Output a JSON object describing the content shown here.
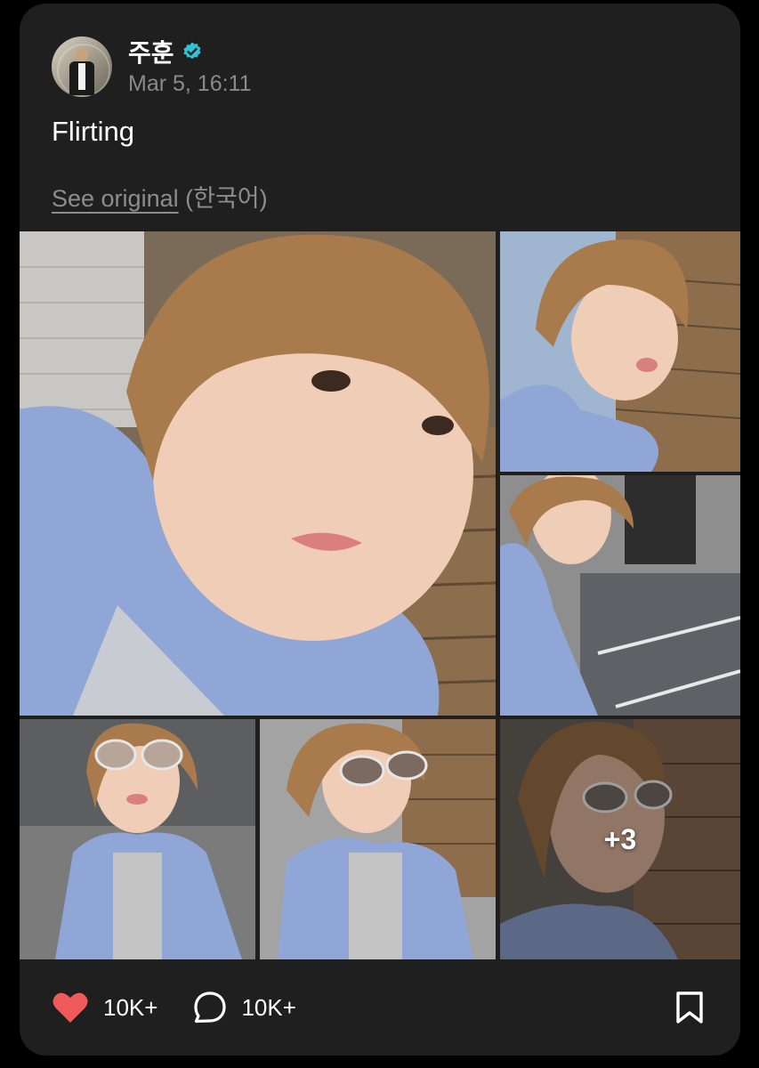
{
  "post": {
    "author_name": "주훈",
    "timestamp": "Mar 5, 16:11",
    "caption": "Flirting",
    "see_original_label": "See original",
    "original_language": "(한국어)"
  },
  "gallery": {
    "more_count_label": "+3"
  },
  "actions": {
    "like_count": "10K+",
    "comment_count": "10K+"
  },
  "colors": {
    "card_background": "#1f1f1f",
    "verified_badge": "#2ec4d6",
    "like_heart": "#ef5a5a",
    "secondary_text": "#8a8a8a"
  },
  "icons": [
    "verified-badge-icon",
    "heart-icon",
    "comment-bubble-icon",
    "bookmark-icon"
  ]
}
